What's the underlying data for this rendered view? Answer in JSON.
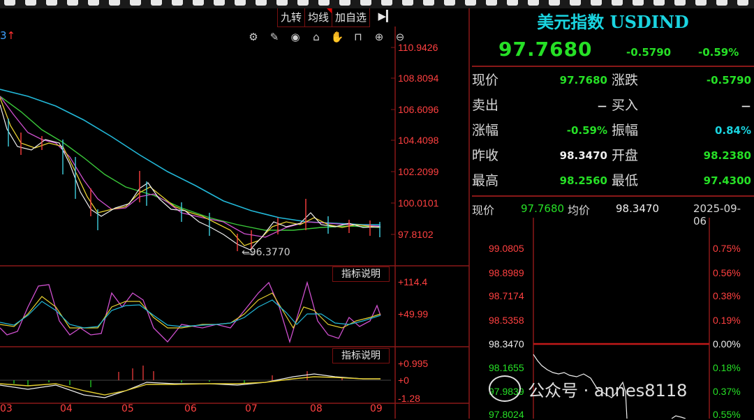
{
  "toolbar": {
    "tabs": [
      {
        "label": "九转"
      },
      {
        "label": "均线"
      },
      {
        "label": "加自选"
      }
    ],
    "expand_icon": "expand-right-icon",
    "tools": [
      "gear-icon",
      "pencil-icon",
      "eye-icon",
      "basket-icon",
      "hand-icon",
      "lock-icon",
      "zoom-in-icon",
      "zoom-out-icon"
    ]
  },
  "main_chart": {
    "corner_label": "3",
    "corner_arrow": "↑",
    "price_axis": [
      "110.9426",
      "108.8094",
      "106.6096",
      "104.4098",
      "102.2099",
      "100.0101",
      "97.8102"
    ],
    "low_annotation": "96.3770",
    "indicator1_button": "指标说明",
    "indicator1_axis": [
      "+114.4",
      "+49.99"
    ],
    "indicator2_button": "指标说明",
    "indicator2_axis": [
      "+0.995",
      "+0",
      "-1.28"
    ],
    "x_labels": [
      "03",
      "04",
      "05",
      "06",
      "07",
      "08",
      "09"
    ]
  },
  "quote": {
    "title": "美元指数 USDIND",
    "price": "97.7680",
    "change": "-0.5790",
    "change_pct": "-0.59%",
    "rows": [
      {
        "l1": "现价",
        "v1": "97.7680",
        "c1": "g",
        "l2": "涨跌",
        "v2": "-0.5790",
        "c2": "g"
      },
      {
        "l1": "卖出",
        "v1": "－",
        "c1": "w",
        "l2": "买入",
        "v2": "－",
        "c2": "w"
      },
      {
        "l1": "涨幅",
        "v1": "-0.59%",
        "c1": "g",
        "l2": "振幅",
        "v2": "0.84%",
        "c2": "c"
      },
      {
        "l1": "昨收",
        "v1": "98.3470",
        "c1": "w",
        "l2": "开盘",
        "v2": "98.2380",
        "c2": "g"
      },
      {
        "l1": "最高",
        "v1": "98.2560",
        "c1": "g",
        "l2": "最低",
        "v2": "97.4300",
        "c2": "g"
      }
    ]
  },
  "minute_chart": {
    "header": {
      "label_now": "现价",
      "now": "97.7680",
      "label_avg": "均价",
      "avg": "98.3470",
      "date": "2025-09-06"
    },
    "left_axis": [
      "99.0805",
      "98.8989",
      "98.7174",
      "98.5358",
      "98.3470",
      "98.1655",
      "97.9839",
      "97.8024"
    ],
    "right_axis": [
      "0.75%",
      "0.56%",
      "0.38%",
      "0.19%",
      "0.00%",
      "0.18%",
      "0.37%",
      "0.55%"
    ]
  },
  "watermark": {
    "text": "公众号 · annes8118"
  },
  "colors": {
    "up": "#ff3030",
    "down": "#26e026",
    "frame": "#8a1818",
    "accent": "#1ad4e0"
  }
}
